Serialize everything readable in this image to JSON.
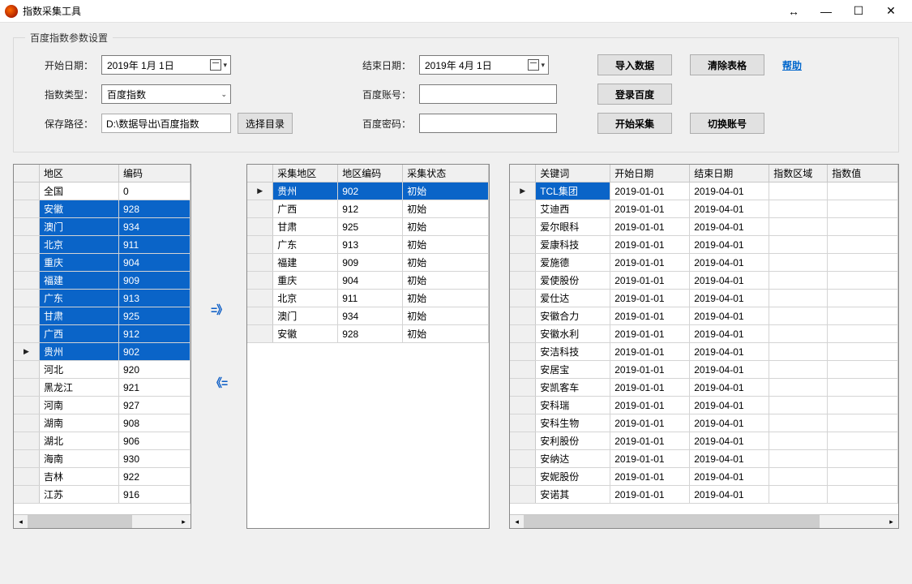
{
  "window": {
    "title": "指数采集工具"
  },
  "fieldset_title": "百度指数参数设置",
  "labels": {
    "start_date": "开始日期：",
    "end_date": "结束日期：",
    "index_type": "指数类型：",
    "baidu_account": "百度账号：",
    "save_path": "保存路径：",
    "baidu_password": "百度密码："
  },
  "values": {
    "start_date": "2019年 1月 1日",
    "end_date": "2019年 4月 1日",
    "index_type": "百度指数",
    "save_path": "D:\\数据导出\\百度指数"
  },
  "buttons": {
    "import_data": "导入数据",
    "clear_table": "清除表格",
    "help": "帮助",
    "login_baidu": "登录百度",
    "choose_dir": "选择目录",
    "start_collect": "开始采集",
    "switch_account": "切换账号"
  },
  "arrows": {
    "right": "=》",
    "left": "《="
  },
  "region_grid": {
    "headers": [
      "地区",
      "编码"
    ],
    "rows": [
      {
        "region": "全国",
        "code": "0",
        "sel": false
      },
      {
        "region": "安徽",
        "code": "928",
        "sel": true
      },
      {
        "region": "澳门",
        "code": "934",
        "sel": true
      },
      {
        "region": "北京",
        "code": "911",
        "sel": true
      },
      {
        "region": "重庆",
        "code": "904",
        "sel": true
      },
      {
        "region": "福建",
        "code": "909",
        "sel": true
      },
      {
        "region": "广东",
        "code": "913",
        "sel": true
      },
      {
        "region": "甘肃",
        "code": "925",
        "sel": true
      },
      {
        "region": "广西",
        "code": "912",
        "sel": true
      },
      {
        "region": "贵州",
        "code": "902",
        "sel": true,
        "cursor": true
      },
      {
        "region": "河北",
        "code": "920",
        "sel": false
      },
      {
        "region": "黑龙江",
        "code": "921",
        "sel": false
      },
      {
        "region": "河南",
        "code": "927",
        "sel": false
      },
      {
        "region": "湖南",
        "code": "908",
        "sel": false
      },
      {
        "region": "湖北",
        "code": "906",
        "sel": false
      },
      {
        "region": "海南",
        "code": "930",
        "sel": false
      },
      {
        "region": "吉林",
        "code": "922",
        "sel": false
      },
      {
        "region": "江苏",
        "code": "916",
        "sel": false
      }
    ]
  },
  "collect_grid": {
    "headers": [
      "采集地区",
      "地区编码",
      "采集状态"
    ],
    "rows": [
      {
        "region": "贵州",
        "code": "902",
        "status": "初始",
        "cursor": true
      },
      {
        "region": "广西",
        "code": "912",
        "status": "初始"
      },
      {
        "region": "甘肃",
        "code": "925",
        "status": "初始"
      },
      {
        "region": "广东",
        "code": "913",
        "status": "初始"
      },
      {
        "region": "福建",
        "code": "909",
        "status": "初始"
      },
      {
        "region": "重庆",
        "code": "904",
        "status": "初始"
      },
      {
        "region": "北京",
        "code": "911",
        "status": "初始"
      },
      {
        "region": "澳门",
        "code": "934",
        "status": "初始"
      },
      {
        "region": "安徽",
        "code": "928",
        "status": "初始"
      }
    ]
  },
  "keyword_grid": {
    "headers": [
      "关键词",
      "开始日期",
      "结束日期",
      "指数区域",
      "指数值"
    ],
    "rows": [
      {
        "kw": "TCL集团",
        "s": "2019-01-01",
        "e": "2019-04-01",
        "cursor": true,
        "hl": true
      },
      {
        "kw": "艾迪西",
        "s": "2019-01-01",
        "e": "2019-04-01"
      },
      {
        "kw": "爱尔眼科",
        "s": "2019-01-01",
        "e": "2019-04-01"
      },
      {
        "kw": "爱康科技",
        "s": "2019-01-01",
        "e": "2019-04-01"
      },
      {
        "kw": "爱施德",
        "s": "2019-01-01",
        "e": "2019-04-01"
      },
      {
        "kw": "爱使股份",
        "s": "2019-01-01",
        "e": "2019-04-01"
      },
      {
        "kw": "爱仕达",
        "s": "2019-01-01",
        "e": "2019-04-01"
      },
      {
        "kw": "安徽合力",
        "s": "2019-01-01",
        "e": "2019-04-01"
      },
      {
        "kw": "安徽水利",
        "s": "2019-01-01",
        "e": "2019-04-01"
      },
      {
        "kw": "安洁科技",
        "s": "2019-01-01",
        "e": "2019-04-01"
      },
      {
        "kw": "安居宝",
        "s": "2019-01-01",
        "e": "2019-04-01"
      },
      {
        "kw": "安凯客车",
        "s": "2019-01-01",
        "e": "2019-04-01"
      },
      {
        "kw": "安科瑞",
        "s": "2019-01-01",
        "e": "2019-04-01"
      },
      {
        "kw": "安科生物",
        "s": "2019-01-01",
        "e": "2019-04-01"
      },
      {
        "kw": "安利股份",
        "s": "2019-01-01",
        "e": "2019-04-01"
      },
      {
        "kw": "安纳达",
        "s": "2019-01-01",
        "e": "2019-04-01"
      },
      {
        "kw": "安妮股份",
        "s": "2019-01-01",
        "e": "2019-04-01"
      },
      {
        "kw": "安诺其",
        "s": "2019-01-01",
        "e": "2019-04-01"
      }
    ]
  }
}
